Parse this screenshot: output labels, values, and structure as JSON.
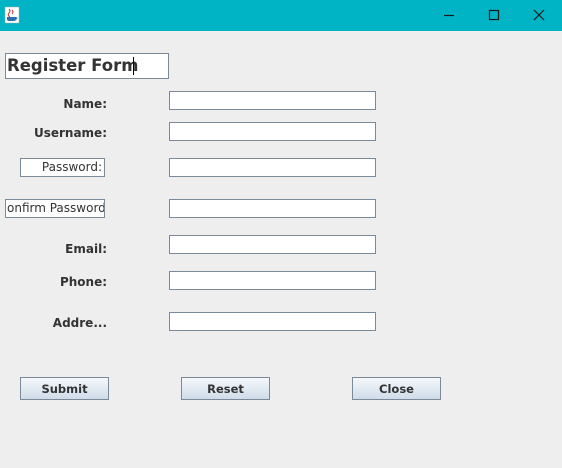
{
  "window": {
    "app_icon": "java-cup-icon",
    "buttons": [
      "minimize-icon",
      "maximize-icon",
      "close-icon"
    ],
    "titlebar_color": "#00b4c6"
  },
  "form": {
    "title": "Register Form",
    "labels": {
      "name": "Name:",
      "username": "Username:",
      "password": "Password:",
      "confirm_password": "onfirm Password:",
      "email": "Email:",
      "phone": "Phone:",
      "address": "Addre..."
    },
    "fields": {
      "name": "",
      "username": "",
      "password": "",
      "confirm_password": "",
      "email": "",
      "phone": "",
      "address": ""
    },
    "buttons": {
      "submit": "Submit",
      "reset": "Reset",
      "close": "Close"
    }
  }
}
